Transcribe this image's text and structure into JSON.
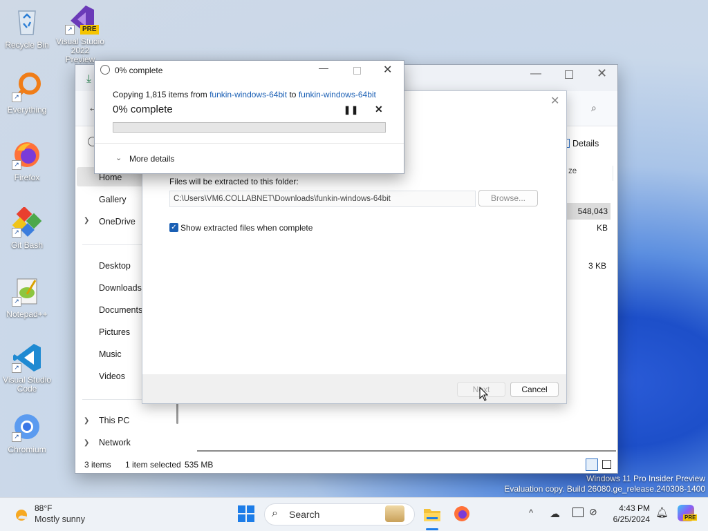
{
  "desktop": {
    "icons": [
      {
        "label": "Recycle Bin"
      },
      {
        "label": "Visual Studio 2022 Preview",
        "badge": "PRE"
      },
      {
        "label": "Everything"
      },
      {
        "label": "Firefox"
      },
      {
        "label": "Git Bash"
      },
      {
        "label": "Notepad++"
      },
      {
        "label": "Visual Studio Code"
      },
      {
        "label": "Chromium"
      }
    ],
    "watermark_line1": "Windows 11 Pro Insider Preview",
    "watermark_line2": "Evaluation copy. Build 26080.ge_release.240308-1400"
  },
  "explorer": {
    "nav": [
      {
        "label": "Home",
        "icon": "home-icon"
      },
      {
        "label": "Gallery",
        "icon": "gallery-icon"
      },
      {
        "label": "OneDrive",
        "icon": "cloud-icon"
      },
      {
        "label": "Desktop",
        "icon": "desktop-icon"
      },
      {
        "label": "Downloads",
        "icon": "download-icon"
      },
      {
        "label": "Documents",
        "icon": "documents-icon"
      },
      {
        "label": "Pictures",
        "icon": "pictures-icon"
      },
      {
        "label": "Music",
        "icon": "music-icon"
      },
      {
        "label": "Videos",
        "icon": "videos-icon"
      },
      {
        "label": "This PC",
        "icon": "pc-icon"
      },
      {
        "label": "Network",
        "icon": "network-icon"
      }
    ],
    "details_label": "Details",
    "size_header": "ze",
    "file_size_1": "548,043 KB",
    "file_size_2": "3 KB",
    "status": {
      "items": "3 items",
      "selected": "1 item selected",
      "size": "535 MB"
    }
  },
  "wizard": {
    "folder_label": "Files will be extracted to this folder:",
    "path_value": "C:\\Users\\VM6.COLLABNET\\Downloads\\funkin-windows-64bit",
    "browse_label": "Browse...",
    "show_files_label": "Show extracted files when complete",
    "show_files_checked": true,
    "next_label": "Next",
    "cancel_label": "Cancel"
  },
  "progress": {
    "title": "0% complete",
    "copy_prefix": "Copying 1,815 items from ",
    "source": "funkin-windows-64bit",
    "copy_to": " to ",
    "destination": "funkin-windows-64bit",
    "percent_label": "0% complete",
    "progress_value": 0,
    "more_details_label": "More details"
  },
  "taskbar": {
    "weather_temp": "88°F",
    "weather_desc": "Mostly sunny",
    "search_placeholder": "Search",
    "time": "4:43 PM",
    "date": "6/25/2024",
    "copilot_badge": "PRE"
  }
}
